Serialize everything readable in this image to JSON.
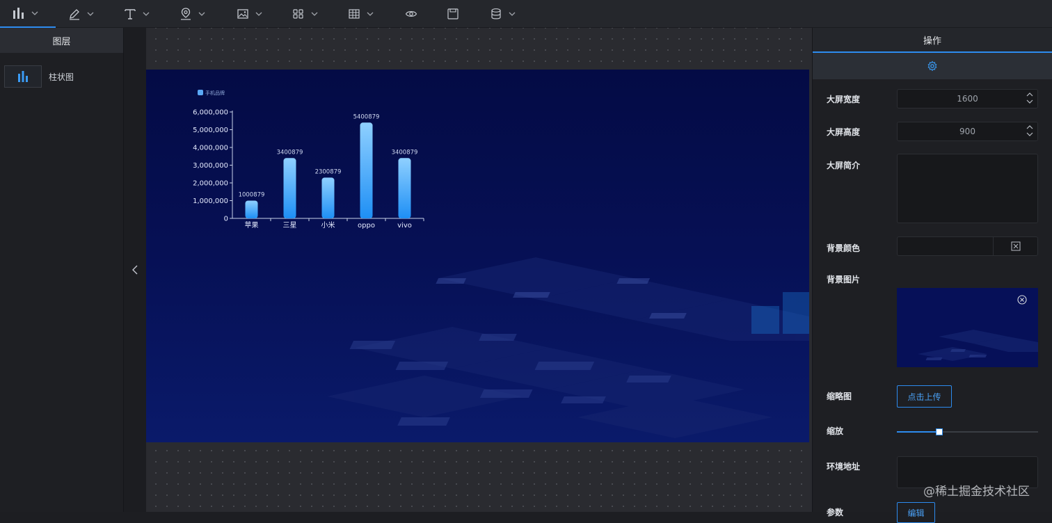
{
  "toolbar": {
    "tools": [
      {
        "icon": "bar-chart-icon"
      },
      {
        "icon": "pen-icon"
      },
      {
        "icon": "text-icon"
      },
      {
        "icon": "map-pin-icon"
      },
      {
        "icon": "image-icon"
      },
      {
        "icon": "grid-icon"
      },
      {
        "icon": "table-icon"
      },
      {
        "icon": "eye-icon"
      },
      {
        "icon": "save-icon"
      },
      {
        "icon": "database-icon"
      }
    ]
  },
  "left_panel": {
    "title": "图层",
    "layers": [
      {
        "label": "柱状图",
        "icon": "bar-chart-icon"
      }
    ]
  },
  "right_panel": {
    "title": "操作",
    "tab_icon": "gear-icon",
    "width_label": "大屏宽度",
    "width_value": "1600",
    "height_label": "大屏高度",
    "height_value": "900",
    "intro_label": "大屏简介",
    "intro_value": "",
    "bg_color_label": "背景颜色",
    "bg_image_label": "背景图片",
    "thumbnail_label": "缩略图",
    "upload_label": "点击上传",
    "scale_label": "缩放",
    "scale_value": 0.3,
    "env_label": "环境地址",
    "params_label": "参数",
    "edit_label": "编辑"
  },
  "watermark": "@稀土掘金技术社区",
  "colors": {
    "accent": "#2d8cf0",
    "screen_bg": "#040b45",
    "bar_top": "#8fd0ff",
    "bar_bottom": "#1e8ff5"
  },
  "chart_data": {
    "type": "bar",
    "legend": "手机品牌",
    "categories": [
      "苹果",
      "三星",
      "小米",
      "oppo",
      "vivo"
    ],
    "values": [
      1000879,
      3400879,
      2300879,
      5400879,
      3400879
    ],
    "data_labels": [
      "1000879",
      "3400879",
      "2300879",
      "5400879",
      "3400879"
    ],
    "ylim": [
      0,
      6000000
    ],
    "yticks": [
      0,
      1000000,
      2000000,
      3000000,
      4000000,
      5000000,
      6000000
    ],
    "ytick_labels": [
      "0",
      "1,000,000",
      "2,000,000",
      "3,000,000",
      "4,000,000",
      "5,000,000",
      "6,000,000"
    ],
    "legend_position": "top-left",
    "grid": false
  }
}
